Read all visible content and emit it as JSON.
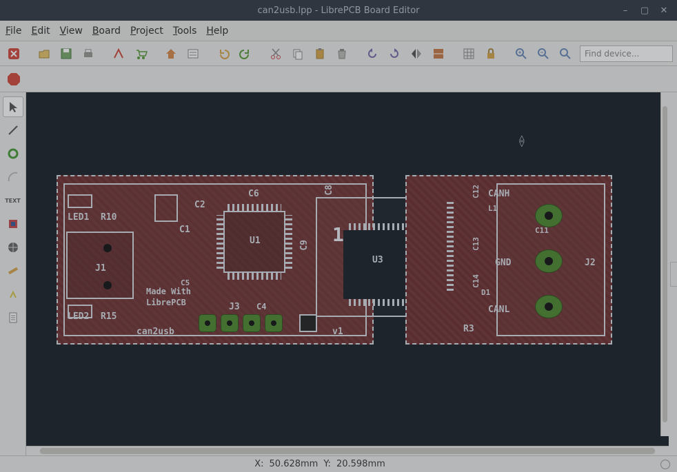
{
  "window": {
    "title": "can2usb.lpp - LibrePCB Board Editor"
  },
  "menu": {
    "file": "File",
    "edit": "Edit",
    "view": "View",
    "board": "Board",
    "project": "Project",
    "tools": "Tools",
    "help": "Help"
  },
  "toolbar": {
    "search_placeholder": "Find device..."
  },
  "left_tools": {
    "text_label": "TEXT"
  },
  "canvas": {
    "big_label": "1",
    "split_cursor_top": "△",
    "split_cursor_bot": "▽"
  },
  "board_left": {
    "refs": {
      "led1": "LED1",
      "r10": "R10",
      "led2": "LED2",
      "r15": "R15",
      "j1": "J1",
      "j3": "J3",
      "c1": "C1",
      "c2": "C2",
      "c4": "C4",
      "c5": "C5",
      "c6": "C6",
      "c8": "C8",
      "c9": "C9",
      "u1": "U1",
      "u3": "U3",
      "v1": "v1",
      "made1": "Made With",
      "made2": "LibrePCB",
      "name": "can2usb"
    }
  },
  "board_right": {
    "refs": {
      "canh": "CANH",
      "gnd": "GND",
      "canl": "CANL",
      "c11": "C11",
      "c12": "C12",
      "c13": "C13",
      "c14": "C14",
      "j2": "J2",
      "l1": "L1",
      "d1": "D1",
      "r3": "R3"
    }
  },
  "status": {
    "x_label": "X:",
    "x_value": "50.628mm",
    "y_label": "Y:",
    "y_value": "20.598mm"
  }
}
